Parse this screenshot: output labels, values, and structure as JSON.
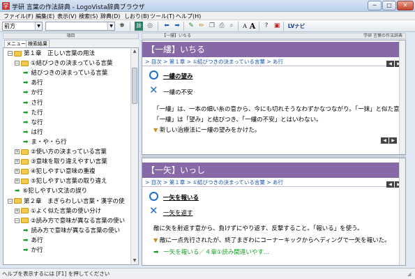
{
  "window": {
    "title": "学研 言葉の作法辞典 - LogoVista辞典ブラウザ",
    "app_icon_label": "学",
    "buttons": {
      "minimize": "─",
      "maximize": "□",
      "close": "✕"
    }
  },
  "menu": {
    "items": [
      "ファイル(F)",
      "編集(E)",
      "表示(V)",
      "検索(S)",
      "辞典(D)",
      "しおり(B)",
      "ツール(T)",
      "ヘルプ(H)"
    ]
  },
  "toolbar": {
    "search_mode": "前方",
    "search_input_value": "",
    "logo_navi": "LVナビ"
  },
  "left_pane": {
    "header": "項目",
    "tabs": [
      "メニュー",
      "検索結果"
    ],
    "tree": [
      {
        "level": 0,
        "type": "folder",
        "expander": "−",
        "label": "第１章　正しい言葉の用法"
      },
      {
        "level": 1,
        "type": "folder",
        "expander": "−",
        "label": "①結びつきの決まっている言葉"
      },
      {
        "level": 2,
        "type": "link",
        "label": "結びつきの決まっている言葉"
      },
      {
        "level": 2,
        "type": "link",
        "label": "あ行"
      },
      {
        "level": 2,
        "type": "link",
        "label": "か行"
      },
      {
        "level": 2,
        "type": "link",
        "label": "さ行"
      },
      {
        "level": 2,
        "type": "link",
        "label": "た行"
      },
      {
        "level": 2,
        "type": "link",
        "label": "な行"
      },
      {
        "level": 2,
        "type": "link",
        "label": "は行"
      },
      {
        "level": 2,
        "type": "link",
        "label": "ま・や・ら行"
      },
      {
        "level": 1,
        "type": "folder",
        "expander": "+",
        "label": "②使い方の決まっている言葉"
      },
      {
        "level": 1,
        "type": "folder",
        "expander": "+",
        "label": "③意味を取り違えやすい言葉"
      },
      {
        "level": 1,
        "type": "folder",
        "expander": "+",
        "label": "④犯しやすい意味の重複"
      },
      {
        "level": 1,
        "type": "folder",
        "expander": "+",
        "label": "⑤犯しやすい言葉の取り違え"
      },
      {
        "level": 1,
        "type": "link",
        "label": "⑥犯しやすい文法の誤り"
      },
      {
        "level": 0,
        "type": "folder",
        "expander": "−",
        "label": "第２章　まぎらわしい言葉・漢字の使"
      },
      {
        "level": 1,
        "type": "folder",
        "expander": "+",
        "label": "①よく似た言葉の使い分け"
      },
      {
        "level": 1,
        "type": "folder",
        "expander": "−",
        "label": "②読み方で意味が異なる言葉の使い"
      },
      {
        "level": 2,
        "type": "link",
        "label": "読み方で意味が異なる言葉の使い"
      },
      {
        "level": 2,
        "type": "link",
        "label": "あ行"
      },
      {
        "level": 2,
        "type": "link",
        "label": "か行"
      }
    ]
  },
  "right_pane": {
    "header_left": "【一縷】いちる",
    "header_right": "学研 言葉の作法辞典",
    "entries": [
      {
        "headword": "【一縷】いちる",
        "breadcrumb": "> 目次 > 第１章 > ①結びつきの決まっている言葉 > あ行",
        "correct": "一縷の望み",
        "wrong": "一縷の不安",
        "body1": "「一縷」は、一本の細い糸の意から、今にも切れそうなわずかなつながり。「一抹」と似た意味をもつが、",
        "body2": "「一縷」は「望み」と結びつき、「一縷の不安」とはいわない。",
        "example": "新しい治療法に一縷の望みをかけた。",
        "link": ""
      },
      {
        "headword": "【一矢】いっし",
        "breadcrumb": "> 目次 > 第１章 > ①結びつきの決まっている言葉 > あ行",
        "correct": "一矢を報いる",
        "wrong": "一矢を返す",
        "body1": "敵に矢を射返す意から、負けずにやり返す、反撃すること。「報いる」を使う。",
        "body2": "",
        "example": "敵に一点先行されたが、終了まぎわにコーナーキックからヘディングで一矢を報いた。",
        "link": "一矢を報いる／４章①読み間違いやす…"
      }
    ]
  },
  "status": {
    "text": "ヘルプを表示するには [F1] を押してください"
  }
}
